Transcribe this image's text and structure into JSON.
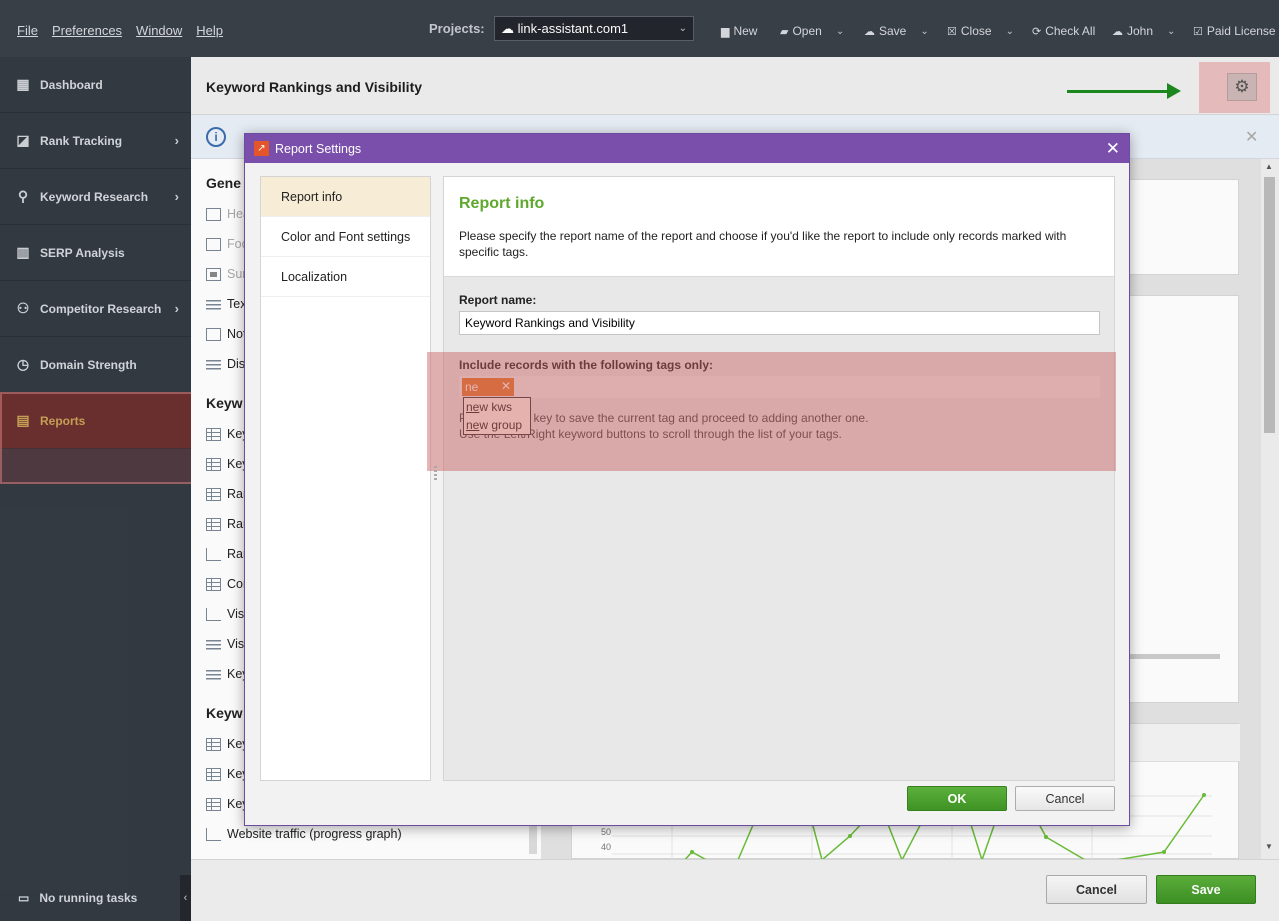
{
  "menu": [
    "File",
    "Preferences",
    "Window",
    "Help"
  ],
  "toolbar": {
    "projects_label": "Projects:",
    "project": "link-assistant.com1",
    "new": "New",
    "open": "Open",
    "save": "Save",
    "close": "Close",
    "check_all": "Check All",
    "user": "John",
    "license": "Paid License"
  },
  "sidebar": {
    "items": [
      {
        "label": "Dashboard",
        "icon": "dashboard-icon"
      },
      {
        "label": "Rank Tracking",
        "icon": "chart-icon"
      },
      {
        "label": "Keyword Research",
        "icon": "search-icon"
      },
      {
        "label": "SERP Analysis",
        "icon": "bars-icon"
      },
      {
        "label": "Competitor Research",
        "icon": "user-icon"
      },
      {
        "label": "Domain Strength",
        "icon": "gauge-icon"
      },
      {
        "label": "Reports",
        "icon": "report-icon"
      }
    ],
    "tasks": "No running tasks"
  },
  "header": {
    "title": "Keyword Rankings and Visibility"
  },
  "left_panel": {
    "sections": [
      "Gene",
      "Keyw",
      "Keyw"
    ],
    "rows": [
      "Hea",
      "Foo",
      "Sur",
      "Tex",
      "Not",
      "Dis",
      "Key",
      "Key",
      "Ran",
      "Ran",
      "Ran",
      "Cor",
      "Vis",
      "Vis",
      "Key",
      "Key",
      "Key",
      "Key",
      "Website traffic (progress graph)"
    ]
  },
  "chart_axis": [
    "50",
    "40"
  ],
  "bottom": {
    "cancel": "Cancel",
    "save": "Save"
  },
  "modal": {
    "title": "Report Settings",
    "nav": [
      "Report info",
      "Color and Font settings",
      "Localization"
    ],
    "content_title": "Report info",
    "description": "Please specify the report name of the report and choose if you'd like the report to include only records marked with specific tags.",
    "report_name_label": "Report name:",
    "report_name_value": "Keyword Rankings and Visibility",
    "tags_label": "Include records with the following tags only:",
    "tag_chip": "ne",
    "suggestions": [
      {
        "match": "ne",
        "rest": "w kws"
      },
      {
        "match": "ne",
        "rest": "w group"
      }
    ],
    "hint_line1": "Press \"Enter\" key to save the current tag and proceed to adding another one.",
    "hint_line2": "Use the Left/Right keyword buttons to scroll through the list of your tags.",
    "ok": "OK",
    "cancel": "Cancel"
  }
}
